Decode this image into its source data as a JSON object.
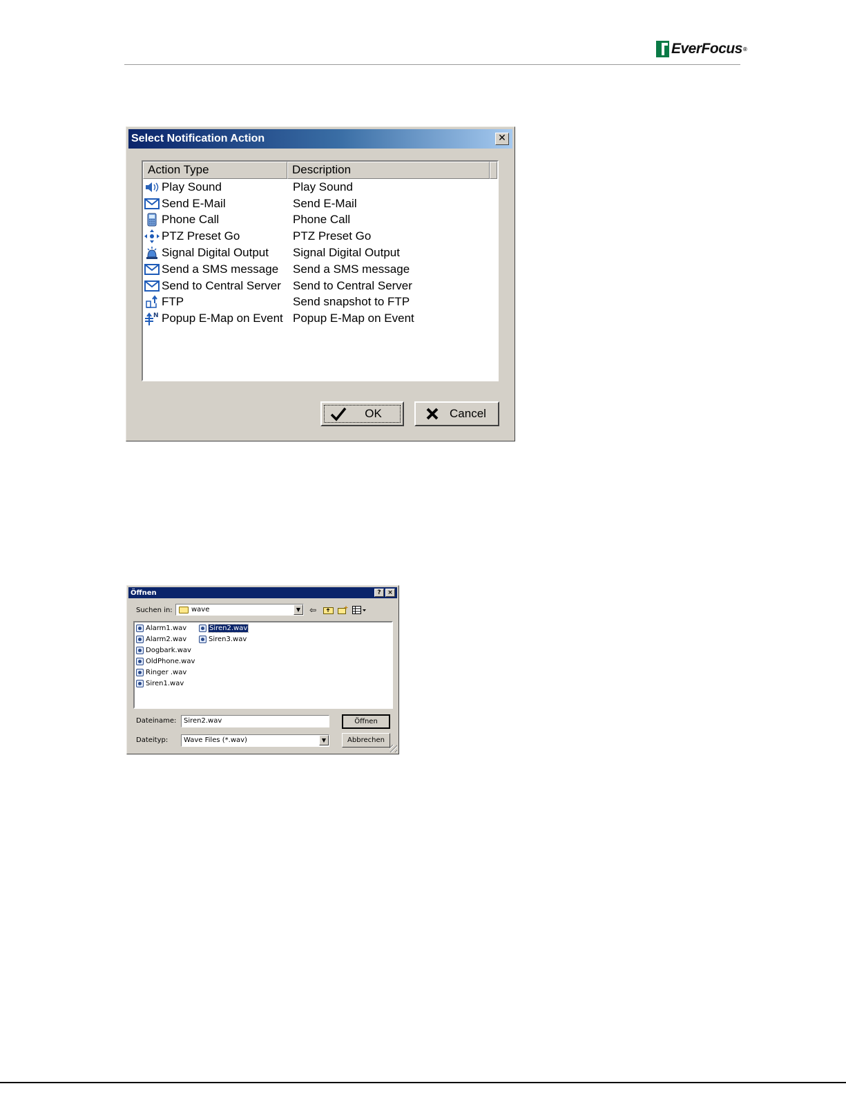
{
  "header": {
    "logo_text": "EverFocus",
    "logo_mark": "®"
  },
  "dialog1": {
    "title": "Select Notification Action",
    "close_label": "✕",
    "columns": [
      "Action Type",
      "Description"
    ],
    "rows": [
      {
        "icon": "speaker-icon",
        "type": "Play Sound",
        "description": "Play Sound"
      },
      {
        "icon": "envelope-icon",
        "type": "Send E-Mail",
        "description": "Send E-Mail"
      },
      {
        "icon": "phone-icon",
        "type": "Phone Call",
        "description": "Phone Call"
      },
      {
        "icon": "ptz-icon",
        "type": "PTZ Preset Go",
        "description": "PTZ Preset Go"
      },
      {
        "icon": "alarm-icon",
        "type": "Signal Digital Output",
        "description": "Signal Digital Output"
      },
      {
        "icon": "envelope-icon",
        "type": "Send a SMS message",
        "description": "Send a SMS message"
      },
      {
        "icon": "envelope-icon",
        "type": "Send to Central Server",
        "description": "Send to Central Server"
      },
      {
        "icon": "ftp-upload-icon",
        "type": "FTP",
        "description": "Send snapshot to FTP"
      },
      {
        "icon": "emap-icon",
        "type": "Popup E-Map on Event",
        "description": "Popup E-Map on Event"
      }
    ],
    "ok_label": "OK",
    "cancel_label": "Cancel"
  },
  "dialog2": {
    "title": "Öffnen",
    "help_label": "?",
    "close_label": "×",
    "lookin_label": "Suchen in:",
    "lookin_value": "wave",
    "files": [
      {
        "name": "Alarm1.wav",
        "selected": false
      },
      {
        "name": "Alarm2.wav",
        "selected": false
      },
      {
        "name": "Dogbark.wav",
        "selected": false
      },
      {
        "name": "OldPhone.wav",
        "selected": false
      },
      {
        "name": "Ringer .wav",
        "selected": false
      },
      {
        "name": "Siren1.wav",
        "selected": false
      },
      {
        "name": "Siren2.wav",
        "selected": true
      },
      {
        "name": "Siren3.wav",
        "selected": false
      }
    ],
    "filename_label": "Dateiname:",
    "filename_value": "Siren2.wav",
    "filetype_label": "Dateityp:",
    "filetype_value": "Wave Files (*.wav)",
    "open_label": "Öffnen",
    "cancel_label": "Abbrechen"
  }
}
